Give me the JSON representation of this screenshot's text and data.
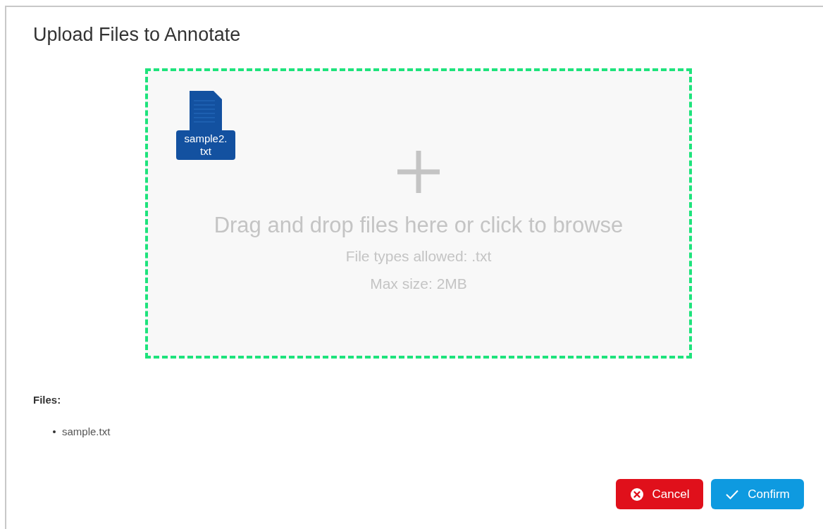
{
  "dialog": {
    "title": "Upload Files to Annotate"
  },
  "dropzone": {
    "dropped_files": [
      {
        "name": "sample2.\ntxt"
      }
    ],
    "prompt": "Drag and drop files here or click to browse",
    "hints": [
      "File types allowed: .txt",
      "Max size: 2MB"
    ]
  },
  "files": {
    "heading": "Files:",
    "items": [
      "sample.txt"
    ]
  },
  "buttons": [
    {
      "kind": "cancel",
      "label": "Cancel"
    },
    {
      "kind": "confirm",
      "label": "Confirm"
    }
  ]
}
